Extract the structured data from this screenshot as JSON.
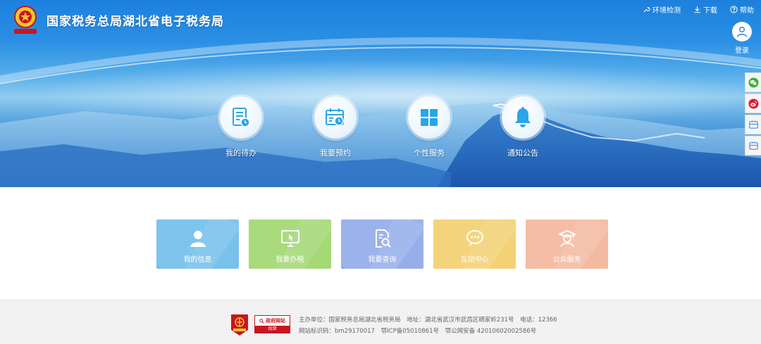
{
  "header": {
    "site_title": "国家税务总局湖北省电子税务局",
    "links": [
      {
        "label": "环境检测",
        "icon": "wrench-icon"
      },
      {
        "label": "下载",
        "icon": "download-icon"
      },
      {
        "label": "帮助",
        "icon": "help-icon"
      }
    ],
    "login_label": "登录"
  },
  "banner_features": [
    {
      "label": "我的待办",
      "icon": "todo-list-icon"
    },
    {
      "label": "我要预约",
      "icon": "calendar-clock-icon"
    },
    {
      "label": "个性服务",
      "icon": "grid-icon"
    },
    {
      "label": "通知公告",
      "icon": "bell-icon"
    }
  ],
  "sidebar": [
    "wechat-icon",
    "weibo-icon",
    "app-icon",
    "app-icon"
  ],
  "tiles": [
    {
      "label": "我的信息",
      "icon": "user-icon",
      "color": "#6dbcea"
    },
    {
      "label": "我要办税",
      "icon": "monitor-icon",
      "color": "#9ed66b"
    },
    {
      "label": "我要查询",
      "icon": "search-document-icon",
      "color": "#8fa8ea"
    },
    {
      "label": "互动中心",
      "icon": "chat-icon",
      "color": "#f2cf6a"
    },
    {
      "label": "公众服务",
      "icon": "public-service-icon",
      "color": "#f4b49a"
    }
  ],
  "footer": {
    "sponsor": "主办单位：国家税务总局湖北省税务局",
    "address": "地址：湖北省武汉市武昌区晒家岭231号",
    "phone": "电话：12366",
    "site_id": "网站标识码：bm29170017",
    "icp": "鄂ICP备05010861号",
    "police": "鄂公网安备 42010602002586号",
    "badge_top": "政府网站",
    "badge_bottom": "找错"
  },
  "colors": {
    "primary": "#1d80dd",
    "icon_blue": "#2aa5e8",
    "badge_red": "#c9151e"
  }
}
